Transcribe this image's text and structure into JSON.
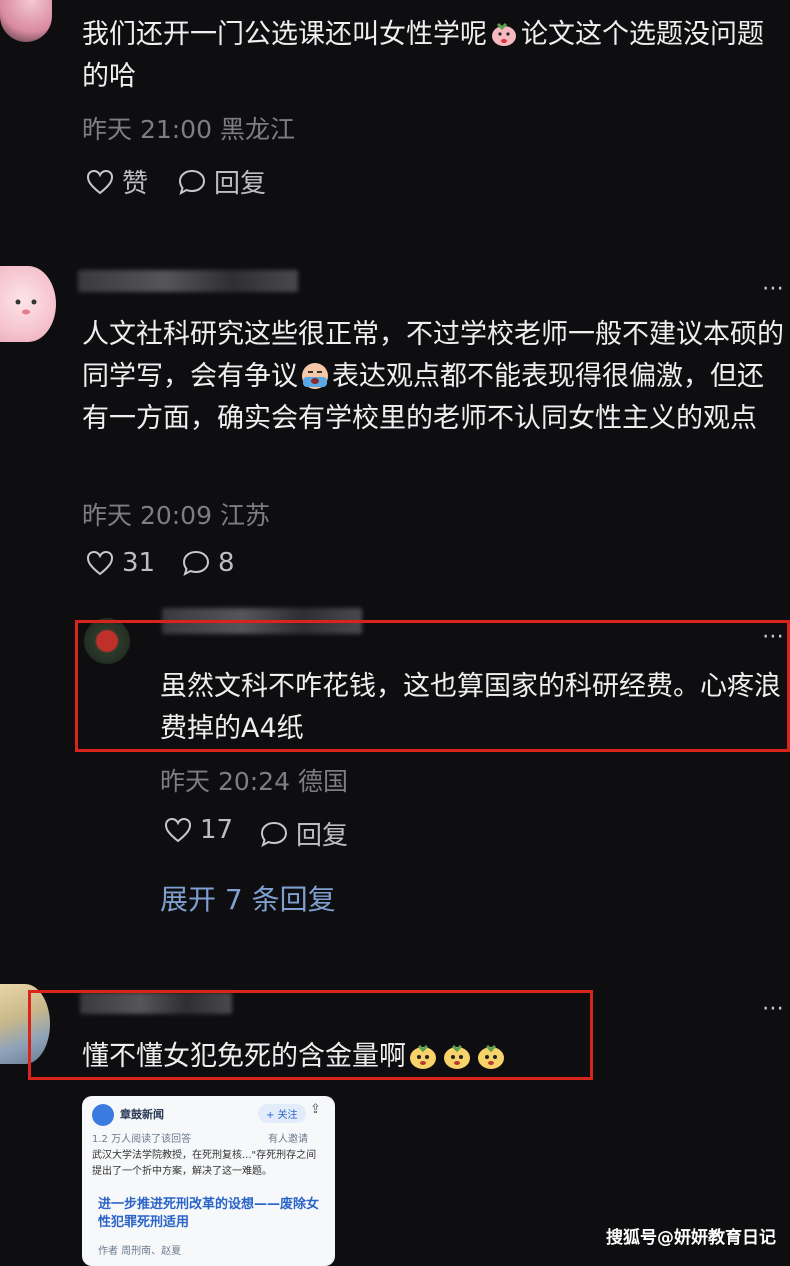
{
  "comments": [
    {
      "text": "我们还开一门公选课还叫女性学呢",
      "text_cont": "论文这个选题没问题的哈",
      "time": "昨天 21:00",
      "location": "黑龙江",
      "like_label": "赞",
      "reply_label": "回复"
    },
    {
      "text_before": "人文社科研究这些很正常，不过学校老师一般不建议本硕的同学写，会有争议",
      "text_after": "表达观点都不能表现得很偏激，但还有一方面，确实会有学校里的老师不认同女性主义的观点",
      "time": "昨天 20:09",
      "location": "江苏",
      "likes": "31",
      "replies": "8"
    },
    {
      "text": "虽然文科不咋花钱，这也算国家的科研经费。心疼浪费掉的A4纸",
      "time": "昨天 20:24",
      "location": "德国",
      "likes": "17",
      "reply_label": "回复",
      "expand_label": "展开 7 条回复"
    },
    {
      "text": "懂不懂女犯免死的含金量啊"
    }
  ],
  "more_icon": "⋯",
  "embedded_card": {
    "source": "章鼓新闻",
    "follow": "+ 关注",
    "views": "1.2 万人阅读了该回答",
    "invite": "有人邀请",
    "body": "武汉大学法学院教授，在死刑复核...\"存死刑存之间提出了一个折中方案，解决了这一难题。",
    "headline": "进一步推进死刑改革的设想——废除女性犯罪死刑适用",
    "footer": "作者    周刑南、赵夏"
  },
  "watermark": "搜狐号@妍妍教育日记",
  "colors": {
    "bg": "#0e0e10",
    "red": "#d9241c",
    "link": "#7f9fd0",
    "meta": "#7d7d82"
  }
}
